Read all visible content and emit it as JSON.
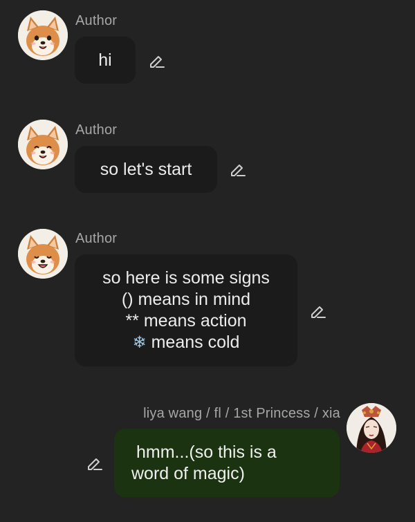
{
  "messages": [
    {
      "sender": "Author",
      "text": "hi",
      "avatar_icon": "shiba-inu-avatar"
    },
    {
      "sender": "Author",
      "text": "so let's start",
      "avatar_icon": "shiba-inu-avatar"
    },
    {
      "sender": "Author",
      "lines": [
        "so here is some signs",
        "() means in mind",
        "** means action",
        "means cold"
      ],
      "snow_glyph": "❄",
      "avatar_icon": "shiba-inu-avatar"
    },
    {
      "sender": "liya wang / fl / 1st Princess / xia",
      "lines": [
        "hmm...(so this is a",
        "word of magic)"
      ],
      "avatar_icon": "princess-portrait-avatar"
    }
  ],
  "icons": {
    "edit": "pencil-edit-icon"
  },
  "colors": {
    "background": "#232323",
    "author_bubble": "#1b1b1b",
    "user_bubble": "#1b3310",
    "name_text": "#a7a7a7"
  }
}
